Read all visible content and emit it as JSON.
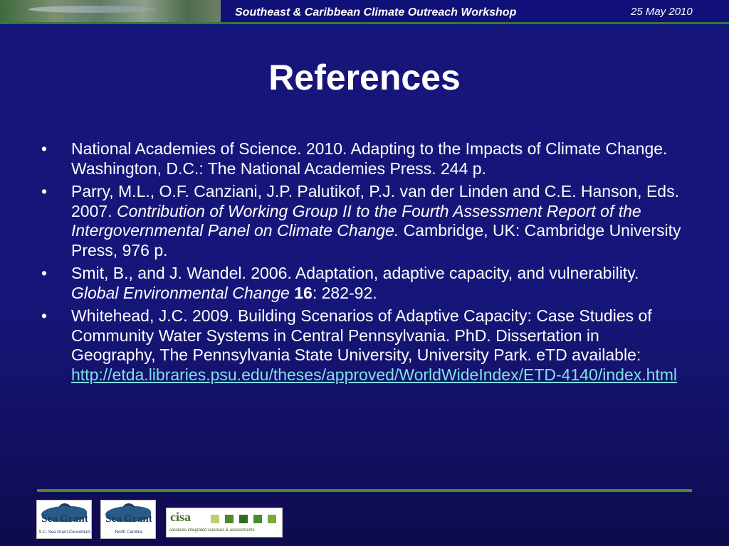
{
  "header": {
    "workshop": "Southeast & Caribbean Climate Outreach Workshop",
    "date": "25 May 2010"
  },
  "slide": {
    "title": "References"
  },
  "references": [
    {
      "text_a": "National Academies of Science. 2010. Adapting to the Impacts of Climate Change. Washington, D.C.: The National Academies Press. 244 p."
    },
    {
      "text_a": "Parry, M.L., O.F. Canziani, J.P. Palutikof, P.J. van der Linden and C.E. Hanson, Eds. 2007. ",
      "italic": "Contribution of Working Group II to the Fourth Assessment Report of the Intergovernmental Panel on Climate Change.",
      "text_b": " Cambridge, UK: Cambridge University Press, 976 p."
    },
    {
      "text_a": "Smit, B., and J. Wandel.  2006.  Adaptation, adaptive capacity, and vulnerability. ",
      "italic": "Global Environmental Change",
      "bold": " 16",
      "text_b": ": 282-92."
    },
    {
      "text_a": "Whitehead, J.C. 2009. Building Scenarios of Adaptive Capacity: Case Studies of Community Water Systems in Central Pennsylvania. PhD. Dissertation in Geography, The Pennsylvania State University, University Park. eTD available: ",
      "link": "http://etda.libraries.psu.edu/theses/approved/WorldWideIndex/ETD-4140/index.html"
    }
  ],
  "bullet_char": "•",
  "logos": {
    "sea_grant_1": {
      "name": "Sea Grant",
      "sub": "S.C. Sea Grant Consortium"
    },
    "sea_grant_2": {
      "name": "Sea Grant",
      "sub": "North Carolina"
    },
    "cisa": {
      "name": "cisa",
      "sub": "carolinas integrated sciences & assessments"
    }
  },
  "colors": {
    "background": "#15157a",
    "accent_line": "#4a8a2c",
    "link": "#7fe0e6",
    "cisa_squares": [
      "#c4cd6a",
      "#4c8a2c",
      "#2f6b24",
      "#4c8a2c",
      "#7aa83a"
    ]
  }
}
